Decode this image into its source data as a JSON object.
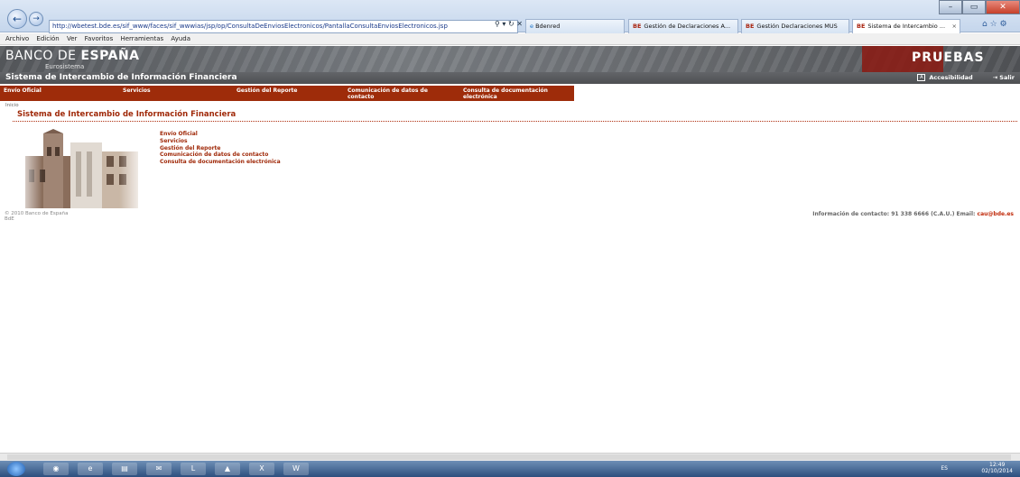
{
  "browser": {
    "address": "http://wbetest.bde.es/sif_www/faces/sif_wwwias/jsp/op/ConsultaDeEnviosElectronicos/PantallaConsultaEnviosElectronicos.jsp",
    "tabs": [
      {
        "label": "Bdenred"
      },
      {
        "label": "Gestión de Declaraciones A..."
      },
      {
        "label": "Gestión Declaraciones MUS"
      },
      {
        "label": "Sistema de Intercambio ..."
      }
    ],
    "menu": [
      "Archivo",
      "Edición",
      "Ver",
      "Favoritos",
      "Herramientas",
      "Ayuda"
    ]
  },
  "header": {
    "logo_left": "BANCO DE ",
    "logo_bold": "ESPAÑA",
    "logo_sub": "Eurosistema",
    "env": "PRUEBAS",
    "title": "Sistema de Intercambio de Información Financiera",
    "accessibility": "Accesibilidad",
    "exit": "Salir"
  },
  "nav": [
    {
      "label": "Envío Oficial"
    },
    {
      "label": "Servicios"
    },
    {
      "label": "Gestión del Reporte"
    },
    {
      "label": "Comunicación de datos de contacto"
    },
    {
      "label": "Consulta de documentación electrónica"
    }
  ],
  "breadcrumb": "Inicio",
  "main": {
    "title": "Sistema de Intercambio de Información Financiera",
    "links": [
      "Envío Oficial",
      "Servicios",
      "Gestión del Reporte",
      "Comunicación de datos de contacto",
      "Consulta de documentación electrónica"
    ]
  },
  "footer": {
    "copyright": "© 2010 Banco de España",
    "bde": "BdE",
    "contact": "Información de contacto: 91 338 6666 (C.A.U.) Email: ",
    "email": "cau@bde.es"
  },
  "taskbar": {
    "lang": "ES",
    "time": "12:49",
    "date": "02/10/2014"
  },
  "colors": {
    "nav_bg": "#9e2c0a",
    "accent_text": "#a02a0a",
    "header_bg": "#636569"
  }
}
